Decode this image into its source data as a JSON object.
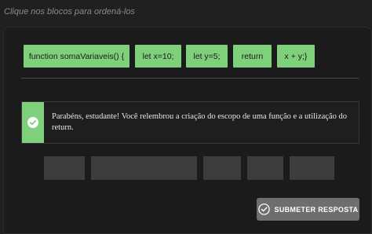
{
  "instruction": "Clique nos blocos para ordená-los",
  "blocks": [
    {
      "label": "function somaVariaveis() {"
    },
    {
      "label": "let x=10;"
    },
    {
      "label": "let y=5;"
    },
    {
      "label": "return"
    },
    {
      "label": "x + y;}"
    }
  ],
  "feedback": {
    "status": "success",
    "message": "Parabéns, estudante! Você relembrou a criação do escopo de uma função e a utilização do return."
  },
  "answer_slots_count": 5,
  "submit_button": {
    "label": "SUBMETER RESPOSTA"
  },
  "colors": {
    "block": "#7fd07a",
    "slot": "#3d3d3d",
    "background": "#202020",
    "submit": "#6e6e6e"
  },
  "icons": {
    "feedback": "check-circle-icon",
    "submit": "check-circle-icon"
  }
}
